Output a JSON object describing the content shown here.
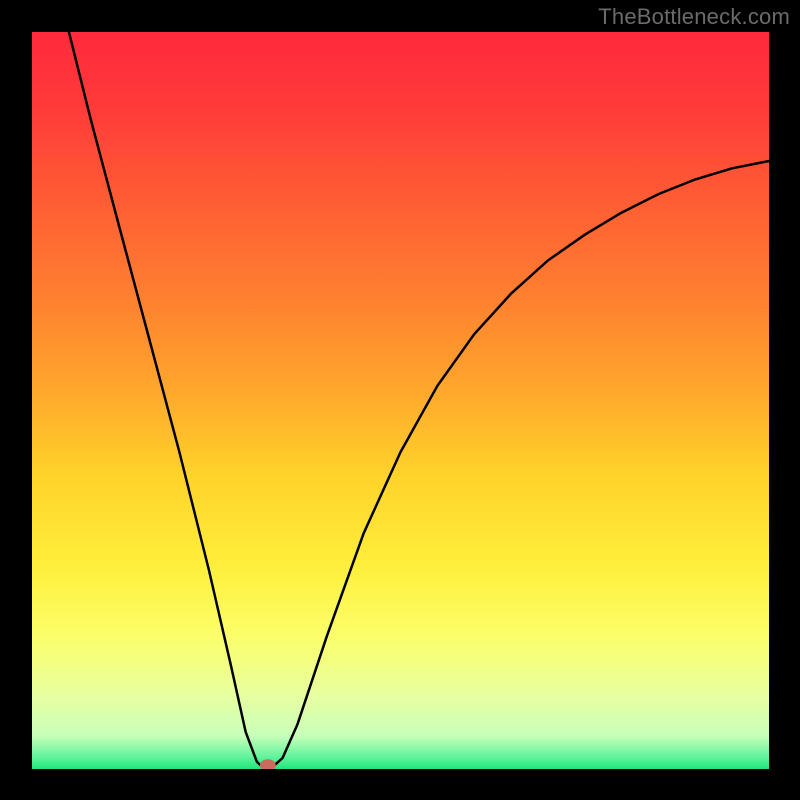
{
  "watermark": "TheBottleneck.com",
  "colors": {
    "gradient_stops": [
      {
        "offset": 0.0,
        "color": "#ff2a3c"
      },
      {
        "offset": 0.1,
        "color": "#ff3a3a"
      },
      {
        "offset": 0.22,
        "color": "#ff5a34"
      },
      {
        "offset": 0.35,
        "color": "#ff7d30"
      },
      {
        "offset": 0.48,
        "color": "#ffa52c"
      },
      {
        "offset": 0.6,
        "color": "#ffd22a"
      },
      {
        "offset": 0.72,
        "color": "#ffee3a"
      },
      {
        "offset": 0.82,
        "color": "#fbff6a"
      },
      {
        "offset": 0.9,
        "color": "#e8ffa0"
      },
      {
        "offset": 0.955,
        "color": "#c8ffba"
      },
      {
        "offset": 0.985,
        "color": "#5cf39a"
      },
      {
        "offset": 1.0,
        "color": "#1fe879"
      }
    ],
    "curve_stroke": "#000000",
    "marker_fill": "#cc6a5e",
    "frame": "#000000"
  },
  "chart_data": {
    "type": "line",
    "title": "",
    "xlabel": "",
    "ylabel": "",
    "xlim": [
      0,
      100
    ],
    "ylim": [
      0,
      100
    ],
    "grid": false,
    "series": [
      {
        "name": "curve",
        "x": [
          5,
          8,
          12,
          16,
          20,
          24,
          27,
          29,
          30.5,
          31,
          32,
          33,
          34,
          36,
          40,
          45,
          50,
          55,
          60,
          65,
          70,
          75,
          80,
          85,
          90,
          95,
          100
        ],
        "y": [
          100,
          88,
          73,
          58,
          43,
          27,
          14,
          5,
          1,
          0.5,
          0.5,
          0.6,
          1.5,
          6,
          18,
          32,
          43,
          52,
          59,
          64.5,
          69,
          72.5,
          75.5,
          78,
          80,
          81.5,
          82.5
        ]
      }
    ],
    "marker": {
      "x": 32,
      "y": 0.5
    },
    "annotations": []
  }
}
